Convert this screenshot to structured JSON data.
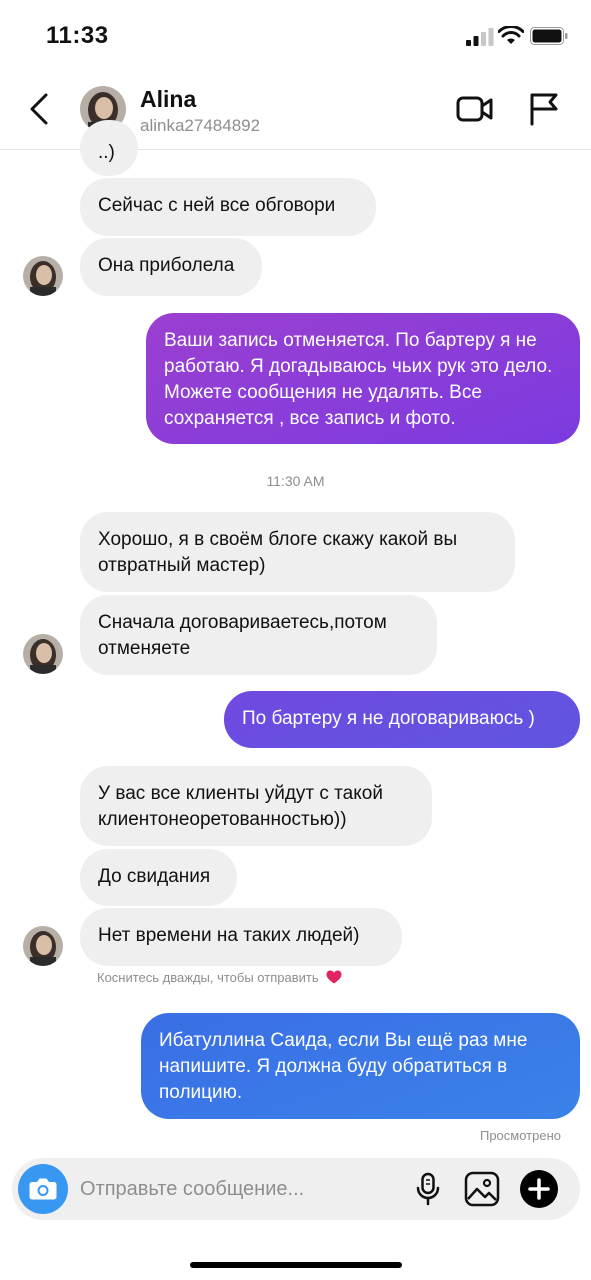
{
  "status_bar": {
    "time": "11:33"
  },
  "header": {
    "name": "Alina",
    "username": "alinka27484892"
  },
  "messages": [
    {
      "text": "..)"
    },
    {
      "text": "Сейчас с ней все обговори"
    },
    {
      "text": "Она приболела"
    },
    {
      "text": "Ваши запись отменяется. По бартеру я не работаю. Я догадываюсь чьих рук это дело. Можете сообщения не удалять. Все сохраняется , все запись и фото."
    },
    {
      "text": "Хорошо, я в своём блоге скажу какой вы отвратный мастер)"
    },
    {
      "text": "Сначала договариваетесь,потом отменяете"
    },
    {
      "text": "По бартеру я не договариваюсь )"
    },
    {
      "text": "У вас все клиенты уйдут с такой клиентонеоретованностью))"
    },
    {
      "text": "До свидания"
    },
    {
      "text": "Нет времени на таких людей)"
    },
    {
      "text": "Ибатуллина Саида, если Вы ещё раз мне напишите. Я должна буду обратиться в полицию."
    }
  ],
  "timestamp": "11:30 AM",
  "double_tap_hint": "Коснитесь дважды, чтобы отправить",
  "seen_label": "Просмотрено",
  "composer": {
    "placeholder": "Отправьте сообщение..."
  },
  "colors": {
    "incoming_bubble": "#efefef",
    "outgoing_purple": "#8a3bd1",
    "outgoing_violet": "#6a4ee0",
    "outgoing_blue": "#3a7ce6",
    "camera_button": "#3897f0"
  }
}
